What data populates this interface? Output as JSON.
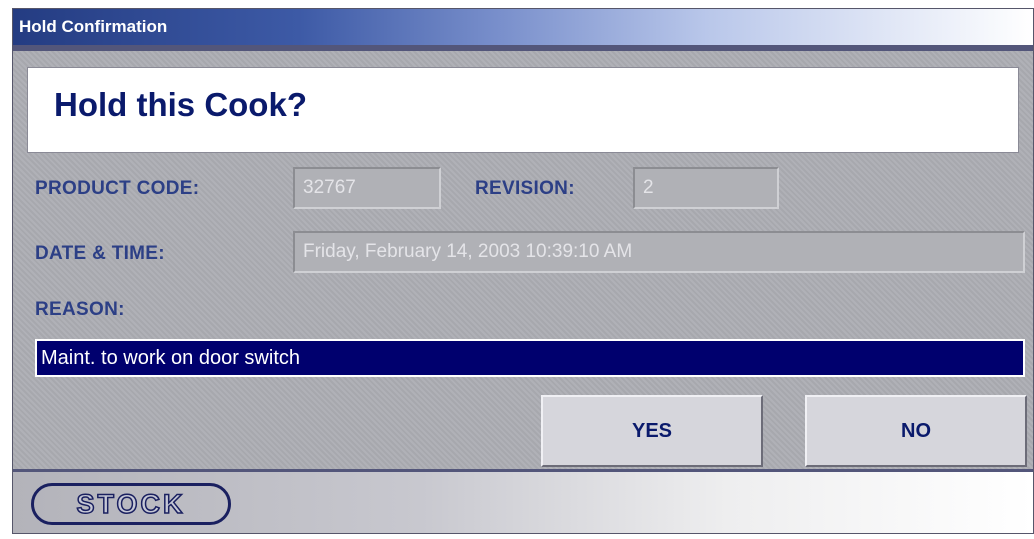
{
  "window": {
    "title": "Hold Confirmation"
  },
  "dialog": {
    "heading": "Hold this Cook?",
    "product_code_label": "PRODUCT CODE:",
    "product_code_value": "32767",
    "revision_label": "REVISION:",
    "revision_value": "2",
    "datetime_label": "DATE & TIME:",
    "datetime_value": "Friday, February 14, 2003  10:39:10 AM",
    "reason_label": "REASON:",
    "reason_value": "Maint. to work on door switch"
  },
  "buttons": {
    "yes": "YES",
    "no": "NO"
  },
  "footer": {
    "logo_text": "STOCK"
  },
  "colors": {
    "title_bar": "#243c82",
    "label_text": "#2c3f86",
    "reason_bg": "#00006e",
    "panel_bg": "#acadb3"
  }
}
